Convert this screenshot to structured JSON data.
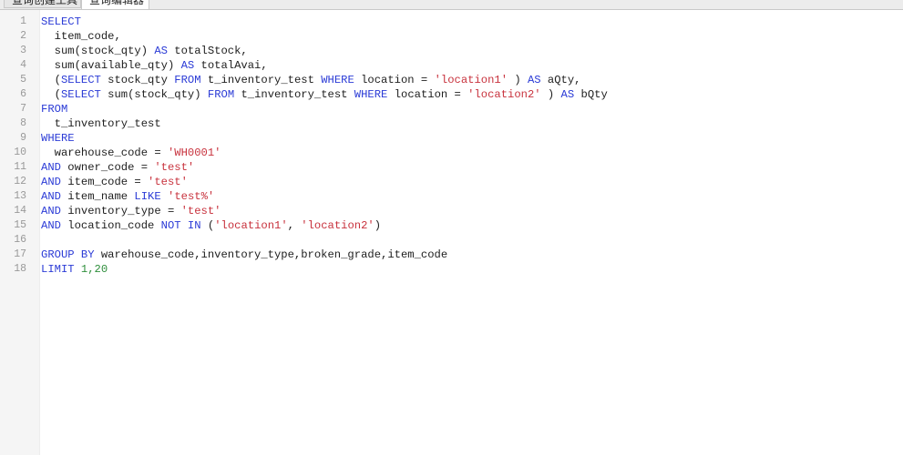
{
  "tabs": [
    "查询创建工具",
    "查询编辑器"
  ],
  "editor": {
    "lines": [
      {
        "n": "1",
        "tokens": [
          {
            "t": "SELECT",
            "c": "kw"
          }
        ]
      },
      {
        "n": "2",
        "tokens": [
          {
            "t": "  item_code,",
            "c": "plain"
          }
        ]
      },
      {
        "n": "3",
        "tokens": [
          {
            "t": "  sum(stock_qty) ",
            "c": "plain"
          },
          {
            "t": "AS",
            "c": "kw"
          },
          {
            "t": " totalStock,",
            "c": "plain"
          }
        ]
      },
      {
        "n": "4",
        "tokens": [
          {
            "t": "  sum(available_qty) ",
            "c": "plain"
          },
          {
            "t": "AS",
            "c": "kw"
          },
          {
            "t": " totalAvai,",
            "c": "plain"
          }
        ]
      },
      {
        "n": "5",
        "tokens": [
          {
            "t": "  (",
            "c": "plain"
          },
          {
            "t": "SELECT",
            "c": "kw"
          },
          {
            "t": " stock_qty ",
            "c": "plain"
          },
          {
            "t": "FROM",
            "c": "kw"
          },
          {
            "t": " t_inventory_test ",
            "c": "plain"
          },
          {
            "t": "WHERE",
            "c": "kw"
          },
          {
            "t": " location = ",
            "c": "plain"
          },
          {
            "t": "'location1'",
            "c": "str"
          },
          {
            "t": " ) ",
            "c": "plain"
          },
          {
            "t": "AS",
            "c": "kw"
          },
          {
            "t": " aQty,",
            "c": "plain"
          }
        ]
      },
      {
        "n": "6",
        "tokens": [
          {
            "t": "  (",
            "c": "plain"
          },
          {
            "t": "SELECT",
            "c": "kw"
          },
          {
            "t": " sum(stock_qty) ",
            "c": "plain"
          },
          {
            "t": "FROM",
            "c": "kw"
          },
          {
            "t": " t_inventory_test ",
            "c": "plain"
          },
          {
            "t": "WHERE",
            "c": "kw"
          },
          {
            "t": " location = ",
            "c": "plain"
          },
          {
            "t": "'location2'",
            "c": "str"
          },
          {
            "t": " ) ",
            "c": "plain"
          },
          {
            "t": "AS",
            "c": "kw"
          },
          {
            "t": " bQty",
            "c": "plain"
          }
        ]
      },
      {
        "n": "7",
        "tokens": [
          {
            "t": "FROM",
            "c": "kw"
          }
        ]
      },
      {
        "n": "8",
        "tokens": [
          {
            "t": "  t_inventory_test",
            "c": "plain"
          }
        ]
      },
      {
        "n": "9",
        "tokens": [
          {
            "t": "WHERE",
            "c": "kw"
          }
        ]
      },
      {
        "n": "10",
        "tokens": [
          {
            "t": "  warehouse_code = ",
            "c": "plain"
          },
          {
            "t": "'WH0001'",
            "c": "str"
          }
        ]
      },
      {
        "n": "11",
        "tokens": [
          {
            "t": "AND",
            "c": "kw"
          },
          {
            "t": " owner_code = ",
            "c": "plain"
          },
          {
            "t": "'test'",
            "c": "str"
          }
        ]
      },
      {
        "n": "12",
        "tokens": [
          {
            "t": "AND",
            "c": "kw"
          },
          {
            "t": " item_code = ",
            "c": "plain"
          },
          {
            "t": "'test'",
            "c": "str"
          }
        ]
      },
      {
        "n": "13",
        "tokens": [
          {
            "t": "AND",
            "c": "kw"
          },
          {
            "t": " item_name ",
            "c": "plain"
          },
          {
            "t": "LIKE",
            "c": "kw"
          },
          {
            "t": " ",
            "c": "plain"
          },
          {
            "t": "'test%'",
            "c": "str"
          }
        ]
      },
      {
        "n": "14",
        "tokens": [
          {
            "t": "AND",
            "c": "kw"
          },
          {
            "t": " inventory_type = ",
            "c": "plain"
          },
          {
            "t": "'test'",
            "c": "str"
          }
        ]
      },
      {
        "n": "15",
        "tokens": [
          {
            "t": "AND",
            "c": "kw"
          },
          {
            "t": " location_code ",
            "c": "plain"
          },
          {
            "t": "NOT IN",
            "c": "kw"
          },
          {
            "t": " (",
            "c": "plain"
          },
          {
            "t": "'location1'",
            "c": "str"
          },
          {
            "t": ", ",
            "c": "plain"
          },
          {
            "t": "'location2'",
            "c": "str"
          },
          {
            "t": ")",
            "c": "plain"
          }
        ]
      },
      {
        "n": "16",
        "tokens": []
      },
      {
        "n": "17",
        "tokens": [
          {
            "t": "GROUP BY",
            "c": "kw"
          },
          {
            "t": " warehouse_code,inventory_type,broken_grade,item_code",
            "c": "plain"
          }
        ]
      },
      {
        "n": "18",
        "tokens": [
          {
            "t": "LIMIT",
            "c": "kw"
          },
          {
            "t": " ",
            "c": "plain"
          },
          {
            "t": "1,20",
            "c": "num"
          }
        ]
      }
    ]
  },
  "colors": {
    "keyword": "#2b3bd6",
    "string": "#c8323d",
    "number": "#2f8f3c",
    "text": "#202020",
    "line_number": "#999999"
  }
}
